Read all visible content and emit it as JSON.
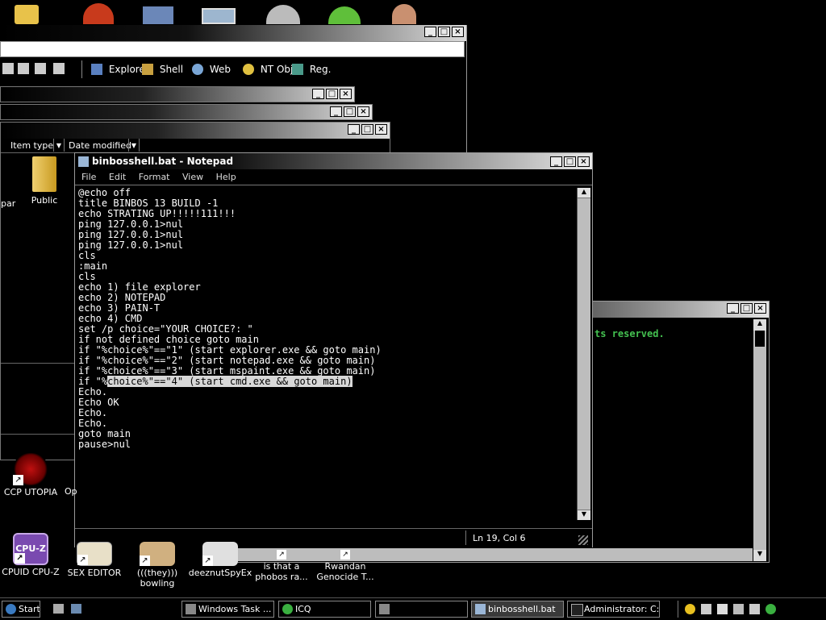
{
  "desktop_icons": [
    {
      "label": "Public"
    },
    {
      "label": "par"
    },
    {
      "label": "CCP UTOPIA"
    },
    {
      "label": "Op"
    },
    {
      "label": "CPUID CPU-Z"
    },
    {
      "label": "SEX EDITOR"
    },
    {
      "label": "(((they))) bowling"
    },
    {
      "label": "deeznutSpyEx"
    },
    {
      "label": "is that a phobos ra..."
    },
    {
      "label": "Rwandan Genocide T..."
    }
  ],
  "back_window": {
    "toolbar": [
      "Explore",
      "Shell",
      "Web",
      "NT Obj",
      "Reg."
    ],
    "columns": [
      "Item type",
      "Date modified"
    ]
  },
  "console_window": {
    "text": "ts reserved."
  },
  "notepad": {
    "title": "binbosshell.bat - Notepad",
    "menu": [
      "File",
      "Edit",
      "Format",
      "View",
      "Help"
    ],
    "lines": [
      "@echo off",
      "title BINBOS 13 BUILD -1",
      "echo STRATING UP!!!!!111!!!",
      "ping 127.0.0.1>nul",
      "ping 127.0.0.1>nul",
      "ping 127.0.0.1>nul",
      "cls",
      ":main",
      "cls",
      "echo 1) file explorer",
      "echo 2) NOTEPAD",
      "echo 3) PAIN-T",
      "echo 4) CMD",
      "set /p choice=\"YOUR CHOICE?: \"",
      "if not defined choice goto main",
      "if \"%choice%\"==\"1\" (start explorer.exe && goto main)",
      "if \"%choice%\"==\"2\" (start notepad.exe && goto main)",
      "if \"%choice%\"==\"3\" (start mspaint.exe && goto main)"
    ],
    "line19_pre": "if \"%",
    "line19_sel": "choice%\"==\"4\" (start cmd.exe && goto main)",
    "lines_after": [
      "Echo.",
      "Echo OK",
      "Echo.",
      "Echo.",
      "goto main",
      "pause>nul"
    ],
    "status": "Ln 19, Col 6"
  },
  "taskbar": {
    "start": "Start",
    "tasks": [
      "Windows Task ...",
      "ICQ",
      "",
      "binbosshell.bat",
      "Administrator: C:..."
    ]
  }
}
